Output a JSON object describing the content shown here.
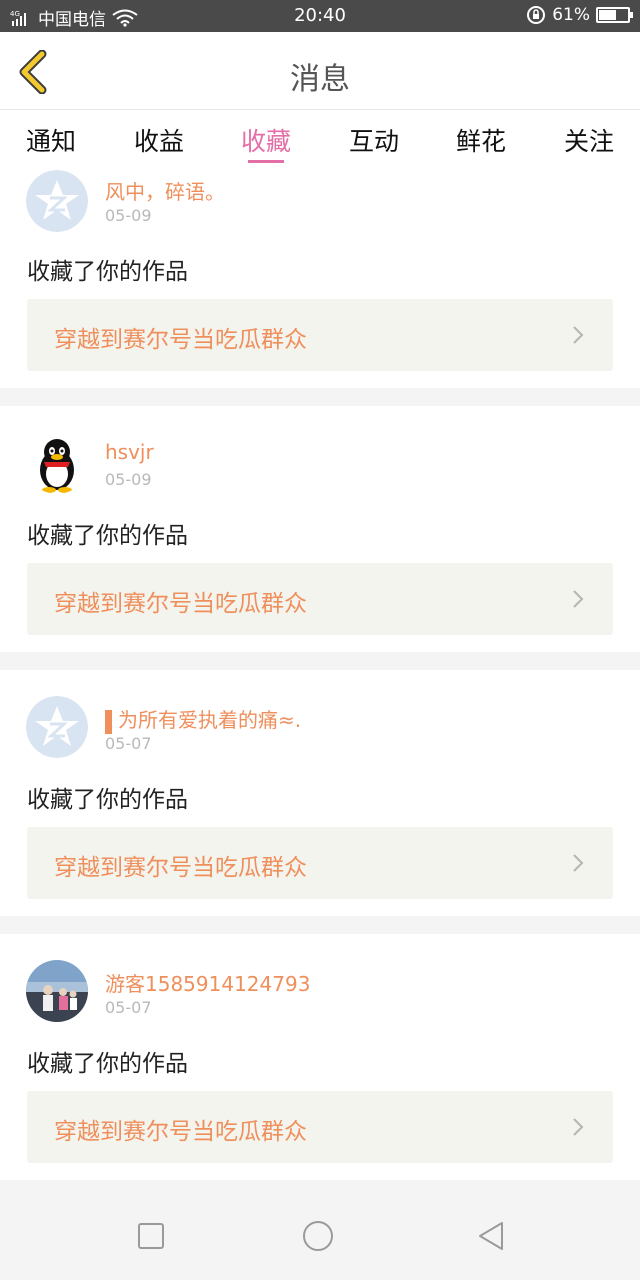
{
  "status": {
    "carrier": "中国电信",
    "network": "4G",
    "time": "20:40",
    "battery": "61%",
    "battery_level": 0.61
  },
  "nav": {
    "title": "消息"
  },
  "tabs": [
    {
      "label": "通知"
    },
    {
      "label": "收益"
    },
    {
      "label": "收藏"
    },
    {
      "label": "互动"
    },
    {
      "label": "鲜花"
    },
    {
      "label": "关注"
    }
  ],
  "active_tab_index": 2,
  "items": [
    {
      "name": "风中，碎语。",
      "date": "05-09",
      "action": "收藏了你的作品",
      "work": "穿越到赛尔号当吃瓜群众",
      "avatar": "qzone-logo"
    },
    {
      "name": "hsvjr",
      "date": "05-09",
      "action": "收藏了你的作品",
      "work": "穿越到赛尔号当吃瓜群众",
      "avatar": "qq-penguin"
    },
    {
      "name": "为所有爱执着的痛≈.",
      "date": "05-07",
      "action": "收藏了你的作品",
      "work": "穿越到赛尔号当吃瓜群众",
      "avatar": "qzone-logo"
    },
    {
      "name": "游客1585914124793",
      "date": "05-07",
      "action": "收藏了你的作品",
      "work": "穿越到赛尔号当吃瓜群众",
      "avatar": "photo"
    }
  ],
  "colors": {
    "accent_pink": "#e36fa6",
    "name_orange": "#ef8f5c",
    "back_yellow": "#f3c92e"
  }
}
